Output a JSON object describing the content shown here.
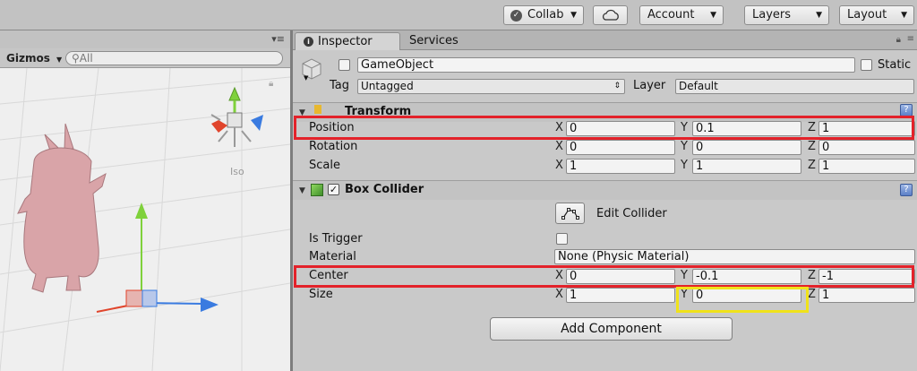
{
  "toolbar": {
    "collab_label": "Collab",
    "account_label": "Account",
    "layers_label": "Layers",
    "layout_label": "Layout"
  },
  "scene": {
    "gizmos_label": "Gizmos",
    "search_placeholder": "All",
    "iso_label": "Iso"
  },
  "inspector": {
    "tabs": [
      {
        "label": "Inspector",
        "active": true
      },
      {
        "label": "Services",
        "active": false
      }
    ],
    "object_name": "GameObject",
    "static_label": "Static",
    "tag_label": "Tag",
    "tag_value": "Untagged",
    "layer_label": "Layer",
    "layer_value": "Default",
    "transform": {
      "title": "Transform",
      "rows": [
        {
          "label": "Position",
          "x": "0",
          "y": "0.1",
          "z": "1"
        },
        {
          "label": "Rotation",
          "x": "0",
          "y": "0",
          "z": "0"
        },
        {
          "label": "Scale",
          "x": "1",
          "y": "1",
          "z": "1"
        }
      ]
    },
    "box_collider": {
      "title": "Box Collider",
      "edit_collider_label": "Edit Collider",
      "is_trigger_label": "Is Trigger",
      "material_label": "Material",
      "material_value": "None (Physic Material)",
      "rows": [
        {
          "label": "Center",
          "x": "0",
          "y": "-0.1",
          "z": "-1"
        },
        {
          "label": "Size",
          "x": "1",
          "y": "0",
          "z": "1"
        }
      ]
    },
    "add_component_label": "Add Component",
    "axes": {
      "x": "X",
      "y": "Y",
      "z": "Z"
    }
  },
  "colors": {
    "highlight_red": "#e3222a",
    "highlight_yellow": "#f0e21a",
    "axis_x": "#e0452c",
    "axis_y": "#7fd13b",
    "axis_z": "#3a7be0"
  }
}
